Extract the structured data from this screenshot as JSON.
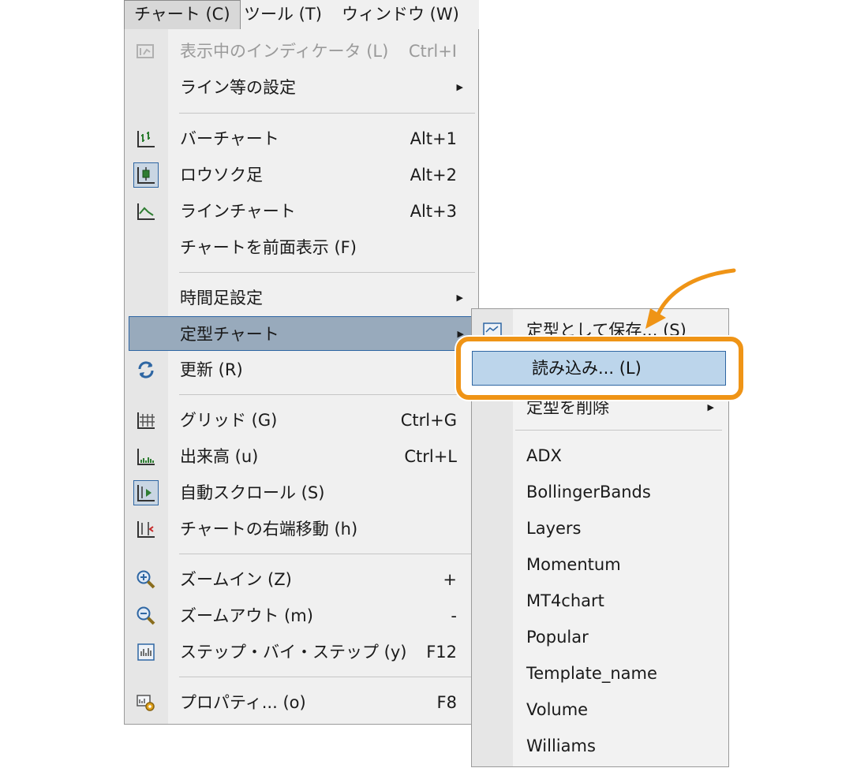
{
  "menubar": {
    "items": [
      {
        "label": "チャート (C)",
        "active": true
      },
      {
        "label": "ツール (T)",
        "active": false
      },
      {
        "label": "ウィンドウ (W)",
        "active": false
      }
    ]
  },
  "main_menu": {
    "indicators": {
      "label": "表示中のインディケータ (L)",
      "shortcut": "Ctrl+I",
      "disabled": true
    },
    "line_settings": {
      "label": "ライン等の設定"
    },
    "bar_chart": {
      "label": "バーチャート",
      "shortcut": "Alt+1"
    },
    "candlestick": {
      "label": "ロウソク足",
      "shortcut": "Alt+2"
    },
    "line_chart": {
      "label": "ラインチャート",
      "shortcut": "Alt+3"
    },
    "chart_foreground": {
      "label": "チャートを前面表示 (F)"
    },
    "timeframe": {
      "label": "時間足設定"
    },
    "template": {
      "label": "定型チャート"
    },
    "refresh": {
      "label": "更新 (R)"
    },
    "grid": {
      "label": "グリッド (G)",
      "shortcut": "Ctrl+G"
    },
    "volume": {
      "label": "出来高 (u)",
      "shortcut": "Ctrl+L"
    },
    "autoscroll": {
      "label": "自動スクロール (S)"
    },
    "chart_shift": {
      "label": "チャートの右端移動 (h)"
    },
    "zoom_in": {
      "label": "ズームイン (Z)",
      "shortcut": "+"
    },
    "zoom_out": {
      "label": "ズームアウト (m)",
      "shortcut": "-"
    },
    "step_by_step": {
      "label": "ステップ・バイ・ステップ (y)",
      "shortcut": "F12"
    },
    "properties": {
      "label": "プロパティ... (o)",
      "shortcut": "F8"
    }
  },
  "submenu": {
    "save_template": {
      "label": "定型として保存... (S)"
    },
    "load_template": {
      "label": "読み込み... (L)"
    },
    "remove_template": {
      "label": "定型を削除"
    },
    "templates": [
      "ADX",
      "BollingerBands",
      "Layers",
      "Momentum",
      "MT4chart",
      "Popular",
      "Template_name",
      "Volume",
      "Williams"
    ]
  },
  "colors": {
    "highlight": "#98aabc",
    "highlight_border": "#2e66a3",
    "callout": "#ef9416",
    "selected_item": "#bcd5eb"
  },
  "icons": {
    "indicators": "indicator-list-icon",
    "bar_chart": "bar-chart-icon",
    "candlestick": "candlestick-icon",
    "line_chart": "line-chart-icon",
    "refresh": "refresh-icon",
    "grid": "grid-icon",
    "volume": "volume-icon",
    "autoscroll": "autoscroll-icon",
    "chart_shift": "chart-shift-icon",
    "zoom_in": "zoom-in-icon",
    "zoom_out": "zoom-out-icon",
    "step_by_step": "step-by-step-icon",
    "properties": "properties-icon",
    "save_template": "save-template-icon"
  }
}
